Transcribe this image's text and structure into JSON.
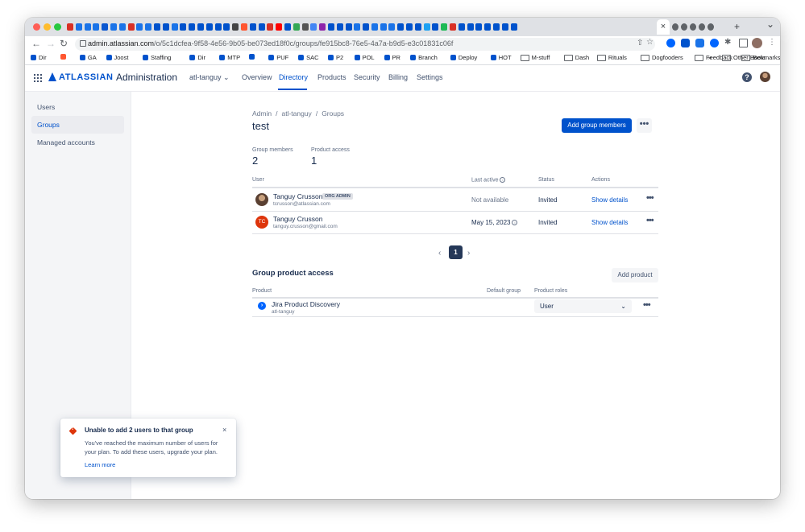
{
  "browser": {
    "active_tab_close": "×",
    "new_tab": "+",
    "tab_menu": "⌄",
    "url_host": "admin.atlassian.com",
    "url_path": "/o/5c1dcfea-9f58-4e56-9b05-be073ed18f0c/groups/fe915bc8-76e5-4a7a-b9d5-e3c01831c06f",
    "favicon_colors": [
      "#d93025",
      "#1a73e8",
      "#1a73e8",
      "#1a73e8",
      "#0b57d0",
      "#1a73e8",
      "#1a73e8",
      "#d93025",
      "#1a73e8",
      "#1a73e8",
      "#0052cc",
      "#0052cc",
      "#1a73e8",
      "#0052cc",
      "#0052cc",
      "#0052cc",
      "#0052cc",
      "#0052cc",
      "#0052cc",
      "#444444",
      "#ff5630",
      "#0052cc",
      "#0052cc",
      "#d93025",
      "#ff0000",
      "#0052cc",
      "#34a853",
      "#555555",
      "#4285f4",
      "#8e24aa",
      "#0052cc",
      "#0052cc",
      "#0052cc",
      "#1a73e8",
      "#0052cc",
      "#1a73e8",
      "#1a73e8",
      "#1a73e8",
      "#0052cc",
      "#0052cc",
      "#0052cc",
      "#1da1f2",
      "#0052cc",
      "#1db954",
      "#d93025",
      "#0052cc",
      "#0052cc",
      "#0052cc",
      "#0052cc",
      "#0052cc",
      "#0052cc",
      "#0052cc"
    ],
    "after_tabs_colors": [
      "#5f6368",
      "#5f6368",
      "#5f6368",
      "#5f6368",
      "#5f6368"
    ],
    "bookmarks": [
      {
        "label": "Dir",
        "color": "#0052cc"
      },
      {
        "label": "",
        "color": "#ff5630"
      },
      {
        "label": "GA",
        "color": "#0052cc"
      },
      {
        "label": "Joost",
        "color": "#0052cc"
      },
      {
        "label": "Staffing",
        "color": "#0052cc"
      },
      {
        "label": "Dir",
        "color": "#0052cc"
      },
      {
        "label": "MTP",
        "color": "#0052cc"
      },
      {
        "label": "",
        "color": "#0052cc"
      },
      {
        "label": "PUF",
        "color": "#0052cc"
      },
      {
        "label": "SAC",
        "color": "#0052cc"
      },
      {
        "label": "P2",
        "color": "#0052cc"
      },
      {
        "label": "POL",
        "color": "#0052cc"
      },
      {
        "label": "PR",
        "color": "#0052cc"
      },
      {
        "label": "Branch",
        "color": "#0052cc"
      },
      {
        "label": "Deploy",
        "color": "#0052cc"
      },
      {
        "label": "HOT",
        "color": "#0052cc"
      },
      {
        "label": "M-stuff",
        "color": "folder"
      },
      {
        "label": "Dash",
        "color": "folder"
      },
      {
        "label": "Rituals",
        "color": "folder"
      },
      {
        "label": "Dogfooders",
        "color": "folder"
      },
      {
        "label": "Feedback",
        "color": "folder"
      },
      {
        "label": "Beta",
        "color": "folder"
      }
    ],
    "bookmarks_overflow": "»",
    "other_bookmarks": "Other Bookmarks"
  },
  "header": {
    "brand": "ATLASSIAN",
    "product": "Administration",
    "org": "atl-tanguy",
    "org_chevron": "⌄",
    "nav": [
      "Overview",
      "Directory",
      "Products",
      "Security",
      "Billing",
      "Settings"
    ],
    "active_nav": "Directory",
    "help": "?",
    "accent": "#0052cc"
  },
  "sidebar": {
    "items": [
      "Users",
      "Groups",
      "Managed accounts"
    ],
    "active": "Groups"
  },
  "breadcrumb": [
    "Admin",
    "atl-tanguy",
    "Groups"
  ],
  "breadcrumb_sep": "/",
  "page": {
    "title": "test",
    "primary_action": "Add group members",
    "more": "•••"
  },
  "stats": {
    "members_label": "Group members",
    "members_value": "2",
    "access_label": "Product access",
    "access_value": "1"
  },
  "members_table": {
    "headers": [
      "User",
      "Last active",
      "Status",
      "Actions"
    ],
    "rows": [
      {
        "name": "Tanguy Crusson",
        "badge": "ORG ADMIN",
        "email": "tcrusson@atlassian.com",
        "last_active": "Not available",
        "status": "Invited",
        "action": "Show details",
        "avatar": "photo"
      },
      {
        "name": "Tanguy Crusson",
        "badge": "",
        "email": "tanguy.crusson@gmail.com",
        "last_active": "May 15, 2023",
        "status": "Invited",
        "action": "Show details",
        "avatar": "TC"
      }
    ],
    "row_more": "•••"
  },
  "pagination": {
    "prev": "‹",
    "current": "1",
    "next": "›"
  },
  "product_access": {
    "title": "Group product access",
    "add_button": "Add product",
    "headers": [
      "Product",
      "Default group",
      "Product roles"
    ],
    "rows": [
      {
        "name": "Jira Product Discovery",
        "site": "atl-tanguy",
        "role": "User",
        "icon": "jpd-icon"
      }
    ],
    "select_chevron": "⌄",
    "row_more": "•••"
  },
  "flag": {
    "title": "Unable to add 2 users to that group",
    "body": "You've reached the maximum number of users for your plan. To add these users, upgrade your plan.",
    "link": "Learn more",
    "close": "×",
    "icon_glyph": "!",
    "icon_color": "#de350b"
  }
}
